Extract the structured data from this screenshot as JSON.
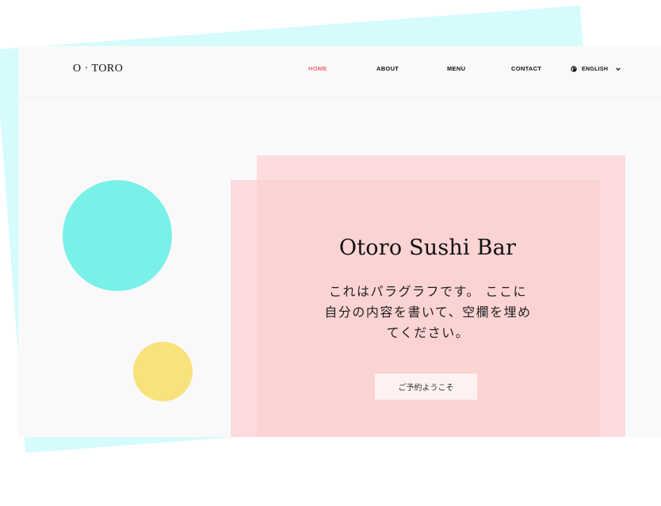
{
  "brand": {
    "logo_text": "O · TORO"
  },
  "nav": {
    "items": [
      {
        "label": "HOME",
        "active": true
      },
      {
        "label": "ABOUT",
        "active": false
      },
      {
        "label": "MENU",
        "active": false
      },
      {
        "label": "CONTACT",
        "active": false
      }
    ],
    "language": {
      "label": "ENGLISH",
      "icon": "globe-icon",
      "chevron": "chevron-down-icon"
    }
  },
  "hero": {
    "title": "Otoro Sushi Bar",
    "paragraph": "これはパラグラフです。 ここに自分の内容を書いて、空欄を埋めてください。",
    "cta_label": "ご予約ようこそ"
  },
  "colors": {
    "backdrop": "#d5fbfd",
    "card": "#f9f9f9",
    "accent_active": "#ef6b6b",
    "circle_teal": "#79f0e8",
    "circle_yellow": "#f9e27b",
    "hero_back": "#fcdcdc",
    "hero_front": "#fccece",
    "cta_bg": "#fdf1f1"
  }
}
